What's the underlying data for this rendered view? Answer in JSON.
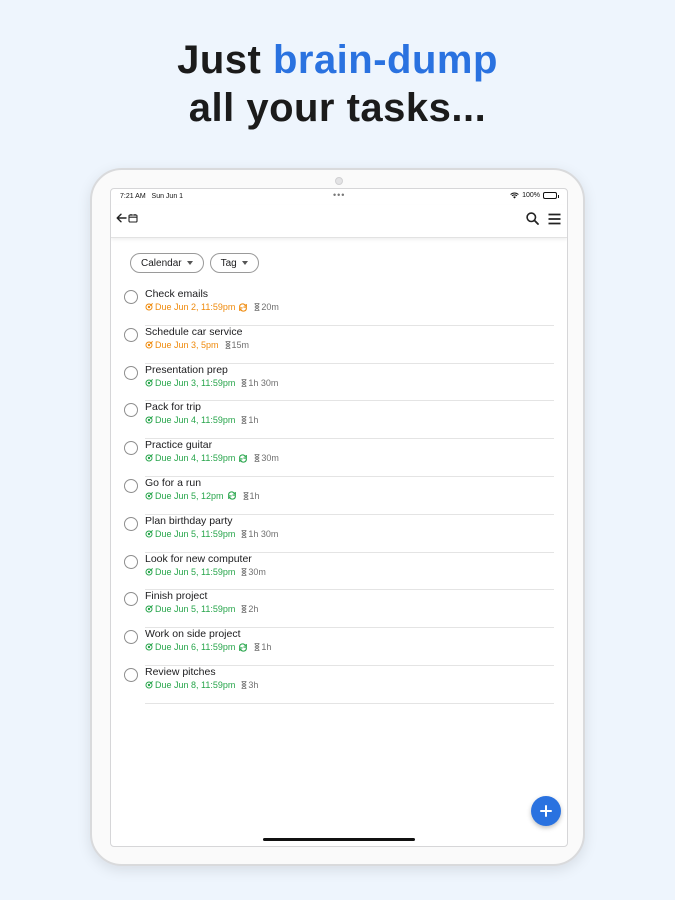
{
  "headline": {
    "line1_prefix": "Just ",
    "line1_accent": "brain-dump",
    "line2": "all your tasks..."
  },
  "colors": {
    "accent": "#2a72e0",
    "due_overdue": "#ef8a0c",
    "due_upcoming": "#27a54b"
  },
  "status_bar": {
    "time": "7:21 AM",
    "date": "Sun Jun 1",
    "battery": "100%"
  },
  "nav": {
    "back_icon": "arrow-left-icon",
    "calendar_icon": "calendar-icon",
    "search_icon": "search-icon",
    "menu_icon": "menu-icon"
  },
  "filters": [
    {
      "label": "Calendar"
    },
    {
      "label": "Tag"
    }
  ],
  "tasks": [
    {
      "title": "Check emails",
      "due": "Due Jun 2, 11:59pm",
      "status": "orange",
      "repeat": true,
      "duration": "20m"
    },
    {
      "title": "Schedule car service",
      "due": "Due Jun 3, 5pm",
      "status": "orange",
      "repeat": false,
      "duration": "15m"
    },
    {
      "title": "Presentation prep",
      "due": "Due Jun 3, 11:59pm",
      "status": "green",
      "repeat": false,
      "duration": "1h 30m"
    },
    {
      "title": "Pack for trip",
      "due": "Due Jun 4, 11:59pm",
      "status": "green",
      "repeat": false,
      "duration": "1h"
    },
    {
      "title": "Practice guitar",
      "due": "Due Jun 4, 11:59pm",
      "status": "green",
      "repeat": true,
      "duration": "30m"
    },
    {
      "title": "Go for a run",
      "due": "Due Jun 5, 12pm",
      "status": "green",
      "repeat": true,
      "duration": "1h"
    },
    {
      "title": "Plan birthday party",
      "due": "Due Jun 5, 11:59pm",
      "status": "green",
      "repeat": false,
      "duration": "1h 30m"
    },
    {
      "title": "Look for new computer",
      "due": "Due Jun 5, 11:59pm",
      "status": "green",
      "repeat": false,
      "duration": "30m"
    },
    {
      "title": "Finish project",
      "due": "Due Jun 5, 11:59pm",
      "status": "green",
      "repeat": false,
      "duration": "2h"
    },
    {
      "title": "Work on side project",
      "due": "Due Jun 6, 11:59pm",
      "status": "green",
      "repeat": true,
      "duration": "1h"
    },
    {
      "title": "Review pitches",
      "due": "Due Jun 8, 11:59pm",
      "status": "green",
      "repeat": false,
      "duration": "3h"
    }
  ],
  "fab": {
    "icon": "plus-icon"
  }
}
